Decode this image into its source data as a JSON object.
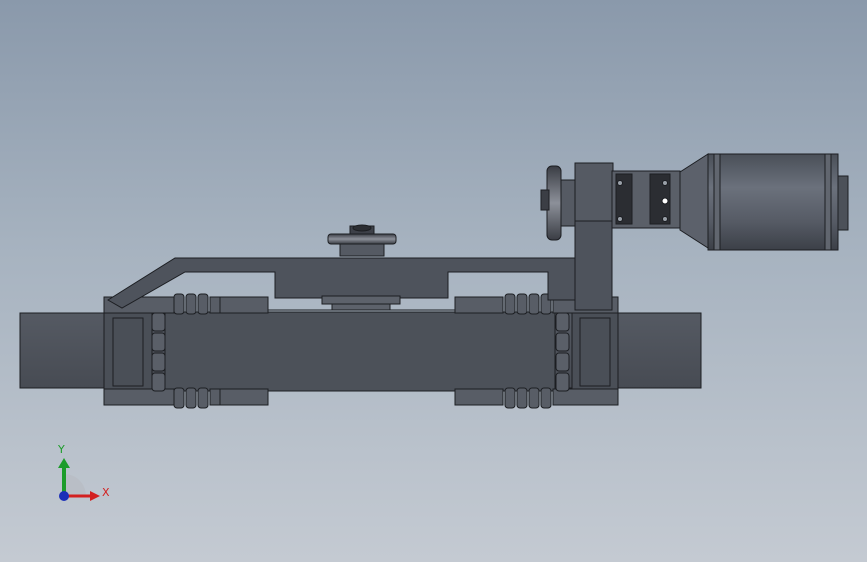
{
  "viewport": {
    "background_top": "#8a99ab",
    "background_bottom": "#c4cad2"
  },
  "model": {
    "part_color": "#4e535c",
    "edge_color": "#1c1e22",
    "highlight_color": "#6a707a",
    "motor_color": "#5a606b"
  },
  "triad": {
    "x_label": "X",
    "y_label": "Y",
    "x_color": "#d32020",
    "y_color": "#1c9c2a",
    "z_color": "#1a2fb8",
    "icons": [
      "x-axis-arrow-icon",
      "y-axis-arrow-icon",
      "z-axis-origin-icon"
    ]
  }
}
